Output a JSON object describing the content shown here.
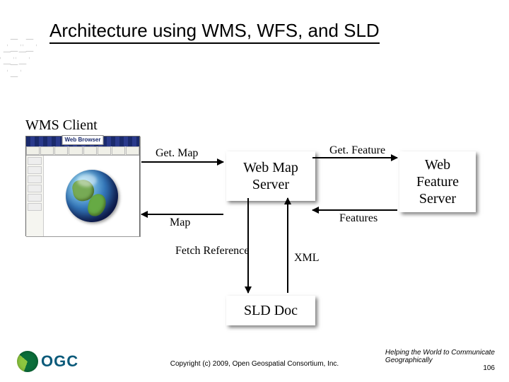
{
  "title": "Architecture using WMS, WFS, and SLD",
  "client_label": "WMS Client",
  "browser_label": "Web Browser",
  "boxes": {
    "wms": "Web Map Server",
    "wfs": "Web Feature Server",
    "sld": "SLD Doc"
  },
  "arrows": {
    "getmap": "Get. Map",
    "map": "Map",
    "getfeature": "Get. Feature",
    "features": "Features",
    "fetchref": "Fetch Reference",
    "xml": "XML"
  },
  "footer": {
    "copyright": "Copyright (c) 2009, Open Geospatial Consortium, Inc.",
    "tagline1": "Helping the World to Communicate",
    "tagline2": "Geographically",
    "page": "106",
    "logo_text": "OGC"
  }
}
